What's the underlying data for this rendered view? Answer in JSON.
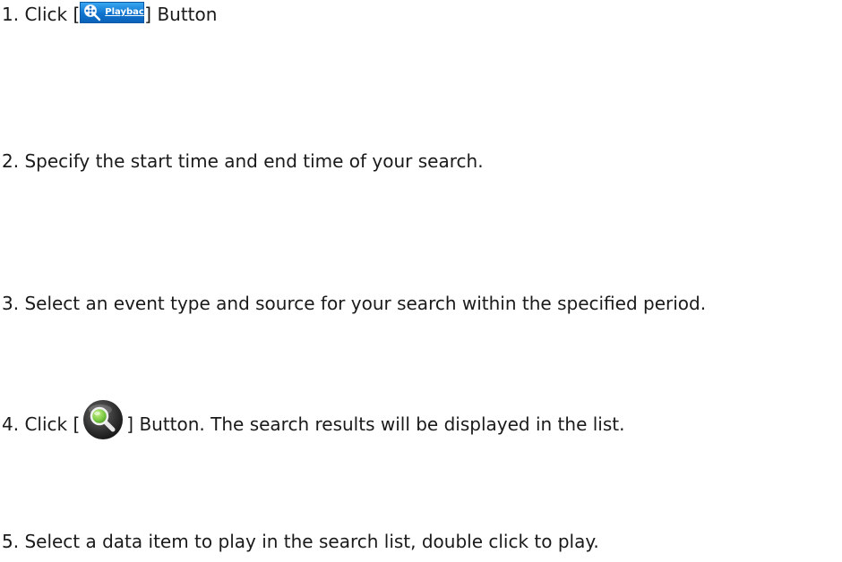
{
  "steps": [
    {
      "number": "1.",
      "before": "Click [",
      "after": "] Button",
      "button": {
        "label": "Playback",
        "icon": "film-reel-magnifier-icon"
      }
    },
    {
      "text": "2. Specify the start time and end time of your search."
    },
    {
      "text": "3. Select an event type and source for your search within the specified period."
    },
    {
      "number": "4.",
      "before": "Click [",
      "after": "] Button. The search results will be displayed in the list.",
      "button": {
        "icon": "search-magnifier-icon"
      }
    },
    {
      "text": "5. Select a data item to play in the search list, double click to play."
    }
  ],
  "colors": {
    "text": "#1a1a1a",
    "playback_button": "#1f86dc",
    "search_button": "#3a3a3a",
    "search_lens": "#7ac943"
  }
}
